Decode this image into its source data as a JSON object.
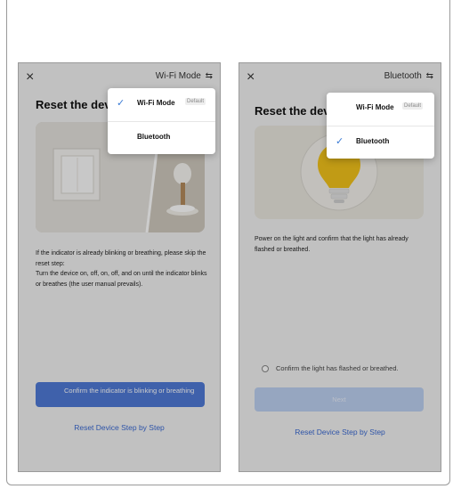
{
  "left": {
    "close_icon": "×",
    "mode_label": "Wi-Fi Mode",
    "swap_icon": "⇆",
    "title": "Reset the dev",
    "description_1": "If the indicator is already blinking or breathing, please skip the reset step:",
    "description_2": "Turn the device on, off, on, off, and on until the indicator blinks or breathes (the user manual prevails).",
    "primary_button": "Confirm the indicator is blinking or breathing",
    "link": "Reset Device Step by Step",
    "menu": {
      "items": [
        {
          "label": "Wi-Fi Mode",
          "badge": "Default",
          "selected": true
        },
        {
          "label": "Bluetooth",
          "badge": "",
          "selected": false
        }
      ]
    }
  },
  "right": {
    "close_icon": "×",
    "mode_label": "Bluetooth",
    "swap_icon": "⇆",
    "title": "Reset the dev",
    "description": "Power on the light and confirm that the light has already flashed or breathed.",
    "confirm_label": "Confirm the light has flashed or breathed.",
    "next_button": "Next",
    "link": "Reset Device Step by Step",
    "menu": {
      "items": [
        {
          "label": "Wi-Fi Mode",
          "badge": "Default",
          "selected": false
        },
        {
          "label": "Bluetooth",
          "badge": "",
          "selected": true
        }
      ]
    }
  },
  "colors": {
    "accent": "#3a7bd5",
    "primary_button": "#4f7ad6",
    "disabled_button": "#bcd0f0",
    "bulb": "#f2c21b"
  },
  "check_icon": "✓"
}
